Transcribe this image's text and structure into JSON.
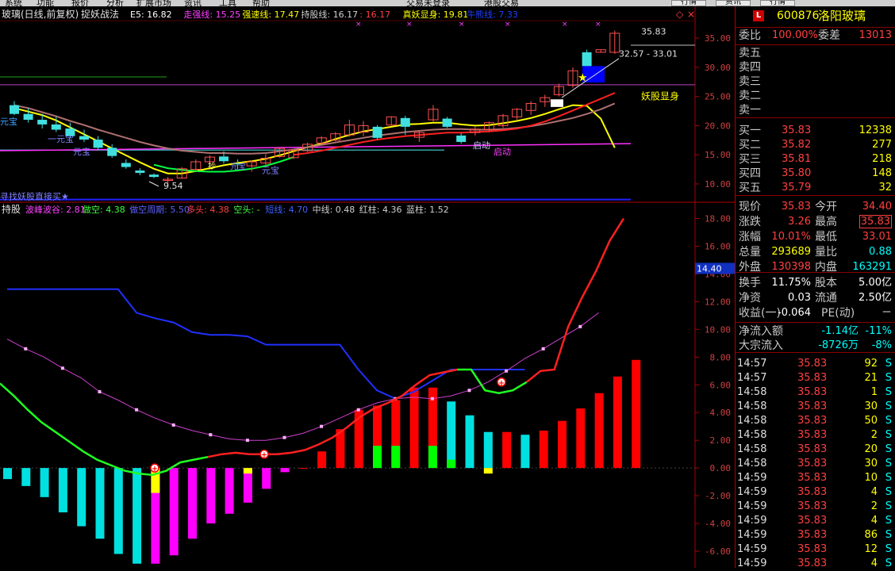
{
  "menu": {
    "items": [
      "系统",
      "功能",
      "报价",
      "分析",
      "扩展市场",
      "资讯",
      "工具",
      "帮助"
    ],
    "right_items": [
      "交易未登录",
      "港股交易"
    ],
    "buttons": [
      "行情",
      "资讯",
      "行情"
    ]
  },
  "main_chart": {
    "stock_name": "玻璃(日线,前复权)",
    "formula": "捉妖战法",
    "indicators": [
      {
        "text": "E5: 16.82",
        "color": "#ffffff"
      },
      {
        "text": "走强线: 15.25",
        "color": "#ff40ff"
      },
      {
        "text": "强速线: 17.47",
        "color": "#ffff00"
      },
      {
        "text": "持股线: 16.17",
        "color": "#d0d0d0"
      },
      {
        "text": ": 16.17",
        "color": "#ff4040"
      },
      {
        "text": "真妖显身: 19.81",
        "color": "#ffff00"
      },
      {
        "text": "牛熊线: 7.33",
        "color": "#2040ff"
      }
    ],
    "y_ticks": [
      "35.00",
      "30.00",
      "25.00",
      "20.00",
      "15.00",
      "10.00"
    ],
    "annotations": {
      "high": "35.83",
      "range": "32.57 - 33.01",
      "demon": "妖股显身",
      "low": "9.54",
      "yuanbao1": "元宝",
      "yuanbao2": "一元宝",
      "yuanbao3": "元宝",
      "yuanbao4": "元宝",
      "jiudong": "启动",
      "qidong": "启动",
      "bottom_text": "寻找妖股直接买★",
      "jiu": "抄",
      "yuan_small": "元宝"
    },
    "chart_data": {
      "type": "candlestick",
      "ylim": [
        7,
        38
      ],
      "ohlc": [
        [
          23.5,
          24.2,
          21.8,
          22.0
        ],
        [
          22.0,
          23.0,
          20.5,
          21.0
        ],
        [
          21.0,
          22.0,
          19.5,
          20.2
        ],
        [
          20.2,
          21.6,
          18.9,
          19.3
        ],
        [
          19.5,
          20.5,
          17.8,
          18.2
        ],
        [
          18.2,
          19.3,
          17.2,
          17.6
        ],
        [
          17.6,
          18.2,
          15.8,
          16.2
        ],
        [
          16.2,
          16.8,
          14.5,
          14.8
        ],
        [
          13.6,
          14.2,
          12.6,
          12.9
        ],
        [
          12.3,
          12.7,
          11.5,
          11.9
        ],
        [
          11.6,
          11.8,
          11.0,
          11.2
        ],
        [
          10.6,
          11.2,
          9.5,
          10.8
        ],
        [
          11.0,
          12.9,
          10.9,
          12.6
        ],
        [
          12.5,
          14.2,
          12.3,
          13.8
        ],
        [
          13.8,
          14.9,
          13.2,
          14.6
        ],
        [
          14.7,
          15.6,
          13.5,
          13.9
        ],
        [
          13.5,
          14.2,
          12.5,
          13.4
        ],
        [
          13.1,
          14.0,
          12.1,
          13.8
        ],
        [
          13.6,
          15.1,
          12.8,
          14.4
        ],
        [
          14.7,
          16.3,
          14.5,
          16.1
        ],
        [
          14.5,
          15.8,
          14.3,
          15.8
        ],
        [
          15.7,
          17.1,
          15.5,
          16.8
        ],
        [
          17.0,
          18.2,
          16.7,
          17.9
        ],
        [
          17.5,
          18.9,
          17.3,
          18.6
        ],
        [
          18.4,
          21.0,
          18.1,
          20.1
        ],
        [
          18.9,
          20.8,
          18.2,
          20.0
        ],
        [
          19.8,
          20.1,
          17.6,
          17.9
        ],
        [
          20.1,
          21.6,
          20.0,
          21.5
        ],
        [
          21.3,
          21.7,
          18.4,
          19.8
        ],
        [
          18.0,
          19.2,
          17.2,
          18.8
        ],
        [
          21.0,
          23.5,
          20.7,
          22.8
        ],
        [
          21.2,
          21.5,
          19.6,
          19.8
        ],
        [
          18.3,
          18.7,
          16.9,
          17.2
        ],
        [
          18.8,
          19.8,
          18.3,
          19.4
        ],
        [
          19.3,
          20.7,
          18.9,
          20.5
        ],
        [
          20.0,
          22.0,
          19.6,
          21.7
        ],
        [
          21.5,
          23.0,
          21.0,
          22.8
        ],
        [
          22.6,
          24.2,
          21.8,
          23.8
        ],
        [
          24.1,
          25.3,
          23.2,
          24.8
        ],
        [
          25.3,
          27.2,
          25.0,
          26.7
        ],
        [
          26.9,
          30.0,
          26.5,
          29.4
        ],
        [
          32.57,
          33.01,
          30.2,
          30.2
        ],
        [
          32.57,
          33.01,
          32.57,
          33.01
        ],
        [
          32.57,
          36.3,
          32.3,
          35.83
        ]
      ],
      "moving_averages": [
        {
          "name": "E5",
          "color": "#ffff00",
          "values": [
            23.0,
            22.4,
            21.8,
            20.9,
            19.7,
            18.5,
            17.3,
            16.1,
            14.9,
            13.7,
            12.6,
            11.8,
            11.8,
            12.2,
            12.7,
            13.2,
            13.6,
            13.9,
            14.3,
            14.9,
            15.6,
            16.3,
            16.9,
            17.7,
            18.4,
            19.0,
            19.4,
            19.8,
            20.2,
            20.3,
            20.5,
            20.5,
            20.2,
            20.0,
            20.1,
            20.4,
            20.8,
            21.3,
            22.0,
            22.8,
            23.5,
            23.4,
            21.2,
            16.2
          ]
        },
        {
          "name": "走强线",
          "color": "#b07070",
          "values": [
            23.5,
            23.0,
            22.3,
            21.6,
            20.8,
            20.1,
            19.3,
            18.6,
            17.9,
            17.2,
            16.6,
            16.1,
            15.7,
            15.5,
            15.3,
            15.3,
            15.2,
            15.2,
            15.3,
            15.6,
            15.9,
            16.3,
            16.7,
            17.1,
            17.5,
            17.9,
            18.3,
            18.6,
            18.9,
            19.1,
            19.3,
            19.4,
            19.4,
            19.3,
            19.3,
            19.4,
            19.6,
            19.9,
            20.3,
            20.8,
            21.3,
            22.0,
            22.8,
            23.8
          ]
        },
        {
          "name": "持股线",
          "color": "#ff2020",
          "values": [
            null,
            null,
            null,
            null,
            null,
            null,
            null,
            null,
            null,
            null,
            null,
            null,
            null,
            null,
            null,
            null,
            null,
            null,
            null,
            null,
            15.0,
            15.3,
            15.7,
            16.2,
            16.7,
            17.2,
            17.6,
            17.9,
            18.2,
            18.4,
            18.6,
            18.8,
            18.8,
            18.9,
            19.0,
            19.2,
            19.5,
            20.0,
            20.7,
            21.6,
            22.6,
            23.6,
            24.6,
            25.6
          ]
        },
        {
          "name": "持股线绿",
          "color": "#00ff40",
          "values": [
            null,
            null,
            null,
            null,
            null,
            null,
            null,
            null,
            null,
            null,
            13.3,
            12.7,
            12.4,
            12.2,
            12.1,
            12.1,
            12.3,
            12.6,
            13.1,
            13.8,
            14.6,
            null,
            null,
            null,
            null,
            null,
            null,
            null,
            null,
            null,
            null,
            null,
            null,
            null,
            null,
            null,
            null,
            null,
            null,
            null,
            null,
            null,
            null,
            null
          ]
        }
      ],
      "pink_line": [
        15.7,
        16.9
      ],
      "cyan_line": 15.8,
      "purple_line": 27.0,
      "blue_line": 7.33
    }
  },
  "sub_chart": {
    "title": "持股",
    "indicators": [
      {
        "text": "波峰波谷: 2.81",
        "color": "#ff40ff"
      },
      {
        "text": "做空: 4.38",
        "color": "#40ff40"
      },
      {
        "text": "做空周期: 5.50",
        "color": "#6060ff"
      },
      {
        "text": "多头: 4.38",
        "color": "#ff4040"
      },
      {
        "text": "空头: -",
        "color": "#40ff40"
      },
      {
        "text": "短线: 4.70",
        "color": "#4060ff"
      },
      {
        "text": "中线: 0.48",
        "color": "#d0d0d0"
      },
      {
        "text": "红柱: 4.36",
        "color": "#d0d0d0"
      },
      {
        "text": "蓝柱: 1.52",
        "color": "#d0d0d0"
      }
    ],
    "y_ticks": [
      "18.00",
      "16.00",
      "14.00",
      "12.00",
      "10.00",
      "8.00",
      "6.00",
      "4.00",
      "2.00",
      "0.00",
      "-2.00",
      "-4.00",
      "-6.00"
    ],
    "cursor_value": "14.40",
    "chart_data": {
      "type": "bar",
      "ylim": [
        -7.2,
        19
      ],
      "bars": [
        {
          "v": -0.8,
          "c": "#00e0e0"
        },
        {
          "v": -1.3,
          "c": "#00e0e0"
        },
        {
          "v": -2.1,
          "c": "#00e0e0"
        },
        {
          "v": -3.2,
          "c": "#00e0e0"
        },
        {
          "v": -4.2,
          "c": "#00e0e0"
        },
        {
          "v": -5.1,
          "c": "#00e0e0"
        },
        {
          "v": -6.2,
          "c": "#00e0e0"
        },
        {
          "v": -6.9,
          "c": "#00e0e0"
        },
        {
          "v": -6.9,
          "c": "#ff00ff",
          "top": "#ffff00",
          "topv": -1.8
        },
        {
          "v": -6.3,
          "c": "#ff00ff"
        },
        {
          "v": -5.1,
          "c": "#ff00ff"
        },
        {
          "v": -4.0,
          "c": "#ff00ff"
        },
        {
          "v": -3.3,
          "c": "#ff00ff"
        },
        {
          "v": -2.5,
          "c": "#ff00ff",
          "top": "#ffff00",
          "topv": -0.4
        },
        {
          "v": -1.5,
          "c": "#ff00ff"
        },
        {
          "v": -0.3,
          "c": "#ff00ff"
        },
        {
          "v": 0,
          "c": "#ff0000"
        },
        {
          "v": 1.2,
          "c": "#ff0000"
        },
        {
          "v": 2.8,
          "c": "#ff0000"
        },
        {
          "v": 4.2,
          "c": "#ff0000"
        },
        {
          "v": 4.5,
          "c": "#ff0000",
          "low": "#00ff00",
          "lowv": 1.6
        },
        {
          "v": 4.9,
          "c": "#ff0000",
          "low": "#00ff00",
          "lowv": 1.6
        },
        {
          "v": 5.8,
          "c": "#ff0000"
        },
        {
          "v": 5.8,
          "c": "#ff0000",
          "low": "#00ff00",
          "lowv": 1.6
        },
        {
          "v": 4.8,
          "c": "#00e0e0",
          "low": "#00ff00",
          "lowv": 0.6
        },
        {
          "v": 3.8,
          "c": "#00e0e0"
        },
        {
          "v": 2.6,
          "c": "#00e0e0",
          "low": "#ffff00",
          "lowv": -0.4
        },
        {
          "v": 2.6,
          "c": "#ff0000"
        },
        {
          "v": 2.4,
          "c": "#00e0e0"
        },
        {
          "v": 2.7,
          "c": "#ff0000"
        },
        {
          "v": 3.4,
          "c": "#ff0000"
        },
        {
          "v": 4.3,
          "c": "#ff0000"
        },
        {
          "v": 5.4,
          "c": "#ff0000"
        },
        {
          "v": 6.6,
          "c": "#ff0000"
        },
        {
          "v": 7.8,
          "c": "#ff0000"
        }
      ],
      "blue_line": [
        12.9,
        12.9,
        12.9,
        12.9,
        12.9,
        12.9,
        12.9,
        11.2,
        10.8,
        10.5,
        9.8,
        9.6,
        9.6,
        9.5,
        8.9,
        8.9,
        8.9,
        8.9,
        8.9,
        7.1,
        5.6,
        5.0,
        5.5,
        6.3,
        7.1,
        7.1,
        7.1,
        7.1,
        7.1,
        null,
        null,
        null,
        null,
        null,
        null
      ],
      "pink_dotted": [
        9.3,
        8.6,
        8.0,
        7.2,
        6.5,
        5.5,
        4.9,
        4.2,
        3.6,
        3.1,
        2.7,
        2.4,
        2.1,
        2.0,
        2.0,
        2.2,
        2.5,
        3.0,
        3.6,
        4.2,
        4.7,
        5.0,
        5.1,
        5.0,
        5.2,
        5.6,
        6.2,
        7.0,
        7.9,
        8.6,
        9.4,
        10.2,
        11.2,
        null,
        null
      ],
      "main_line": [
        6.1,
        5.2,
        4.2,
        3.3,
        2.6,
        1.9,
        1.2,
        0.6,
        0.2,
        -0.2,
        -0.4,
        -0.5,
        -0.2,
        0.4,
        0.6,
        0.8,
        1.0,
        1.1,
        1.0,
        1.0,
        1.0,
        1.1,
        1.3,
        1.7,
        2.2,
        2.9,
        3.7,
        4.3,
        4.7,
        5.2,
        6.0,
        6.7,
        6.9,
        7.1,
        7.1,
        5.6,
        5.4,
        5.6,
        6.2,
        7.0,
        7.1,
        10.2,
        12.3,
        14.2,
        16.4,
        18.0
      ]
    }
  },
  "right_panel": {
    "code": "600876",
    "name": "洛阳玻璃",
    "wb_label": "委比",
    "wb_value": "100.00%",
    "wc_label": "委差",
    "wc_value": "13013",
    "sell": [
      {
        "label": "卖五",
        "price": "",
        "vol": ""
      },
      {
        "label": "卖四",
        "price": "",
        "vol": ""
      },
      {
        "label": "卖三",
        "price": "",
        "vol": ""
      },
      {
        "label": "卖二",
        "price": "",
        "vol": ""
      },
      {
        "label": "卖一",
        "price": "",
        "vol": ""
      }
    ],
    "buy": [
      {
        "label": "买一",
        "price": "35.83",
        "vol": "12338"
      },
      {
        "label": "买二",
        "price": "35.82",
        "vol": "277"
      },
      {
        "label": "买三",
        "price": "35.81",
        "vol": "218"
      },
      {
        "label": "买四",
        "price": "35.80",
        "vol": "148"
      },
      {
        "label": "买五",
        "price": "35.79",
        "vol": "32"
      }
    ],
    "quote": [
      {
        "l1": "现价",
        "v1": "35.83",
        "c1": "#ff4040",
        "l2": "今开",
        "v2": "34.40",
        "c2": "#ff4040"
      },
      {
        "l1": "涨跌",
        "v1": "3.26",
        "c1": "#ff4040",
        "l2": "最高",
        "v2": "35.83",
        "c2": "#ff4040",
        "box": true
      },
      {
        "l1": "涨幅",
        "v1": "10.01%",
        "c1": "#ff4040",
        "l2": "最低",
        "v2": "33.01",
        "c2": "#ff4040"
      },
      {
        "l1": "总量",
        "v1": "293689",
        "c1": "#ffff00",
        "l2": "量比",
        "v2": "0.88",
        "c2": "#00ffff"
      },
      {
        "l1": "外盘",
        "v1": "130398",
        "c1": "#ff4040",
        "l2": "内盘",
        "v2": "163291",
        "c2": "#00ffff"
      }
    ],
    "finance": [
      {
        "l1": "换手",
        "v1": "11.75%",
        "c1": "#ffffff",
        "l2": "股本",
        "v2": "5.00亿",
        "c2": "#ffffff"
      },
      {
        "l1": "净资",
        "v1": "0.03",
        "c1": "#ffffff",
        "l2": "流通",
        "v2": "2.50亿",
        "c2": "#ffffff"
      },
      {
        "l1": "收益(一)",
        "v1": "-0.064",
        "c1": "#ffffff",
        "l2": "PE(动)",
        "v2": "－",
        "c2": "#ffffff"
      }
    ],
    "flow": [
      {
        "label": "净流入额",
        "v1": "-1.14亿",
        "v2": "-11%"
      },
      {
        "label": "大宗流入",
        "v1": "-8726万",
        "v2": "-8%"
      }
    ],
    "ticks": [
      {
        "t": "14:57",
        "p": "35.83",
        "v": "92",
        "s": "S"
      },
      {
        "t": "14:57",
        "p": "35.83",
        "v": "21",
        "s": "S"
      },
      {
        "t": "14:58",
        "p": "35.83",
        "v": "1",
        "s": "S"
      },
      {
        "t": "14:58",
        "p": "35.83",
        "v": "30",
        "s": "S"
      },
      {
        "t": "14:58",
        "p": "35.83",
        "v": "50",
        "s": "S"
      },
      {
        "t": "14:58",
        "p": "35.83",
        "v": "2",
        "s": "S"
      },
      {
        "t": "14:58",
        "p": "35.83",
        "v": "20",
        "s": "S"
      },
      {
        "t": "14:58",
        "p": "35.83",
        "v": "30",
        "s": "S"
      },
      {
        "t": "14:59",
        "p": "35.83",
        "v": "10",
        "s": "S"
      },
      {
        "t": "14:59",
        "p": "35.83",
        "v": "4",
        "s": "S"
      },
      {
        "t": "14:59",
        "p": "35.83",
        "v": "2",
        "s": "S"
      },
      {
        "t": "14:59",
        "p": "35.83",
        "v": "4",
        "s": "S"
      },
      {
        "t": "14:59",
        "p": "35.83",
        "v": "86",
        "s": "S"
      },
      {
        "t": "14:59",
        "p": "35.83",
        "v": "12",
        "s": "S"
      },
      {
        "t": "14:59",
        "p": "35.83",
        "v": "4",
        "s": "S"
      }
    ]
  }
}
